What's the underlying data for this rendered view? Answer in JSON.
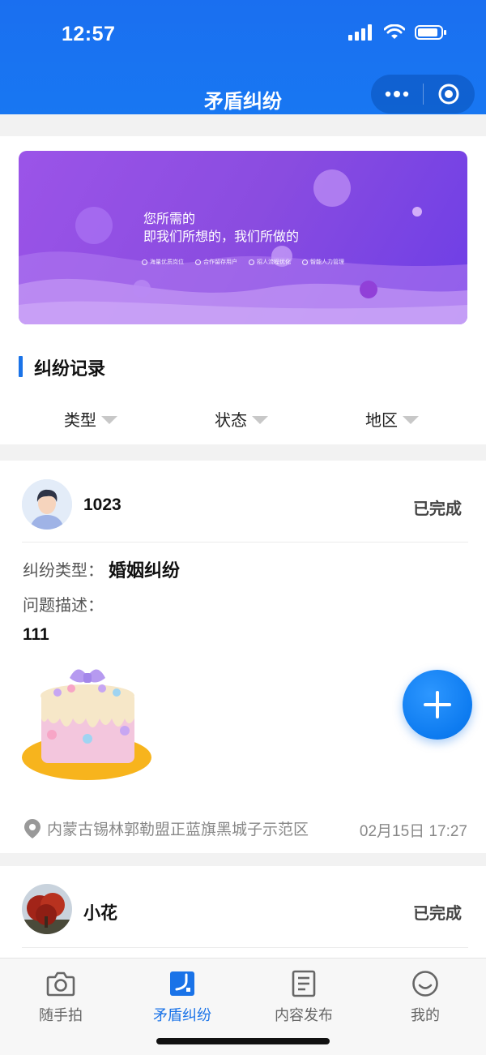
{
  "status_bar": {
    "time": "12:57"
  },
  "header": {
    "title": "矛盾纠纷"
  },
  "banner": {
    "line1": "您所需的",
    "line2": "即我们所想的，我们所做的",
    "bullets": [
      "海量优质岗位",
      "合作留存用户",
      "招人流程优化",
      "智能人力管理"
    ]
  },
  "section": {
    "title": "纠纷记录"
  },
  "filters": [
    {
      "label": "类型"
    },
    {
      "label": "状态"
    },
    {
      "label": "地区"
    }
  ],
  "records": [
    {
      "name": "1023",
      "status": "已完成",
      "type_label": "纠纷类型：",
      "type_value": "婚姻纠纷",
      "desc_label": "问题描述：",
      "desc_value": "111",
      "location": "内蒙古锡林郭勒盟正蓝旗黑城子示范区",
      "time": "02月15日 17:27"
    },
    {
      "name": "小花",
      "status": "已完成"
    }
  ],
  "tabbar": {
    "tabs": [
      {
        "label": "随手拍",
        "icon": "camera-icon"
      },
      {
        "label": "矛盾纠纷",
        "icon": "dispute-icon"
      },
      {
        "label": "内容发布",
        "icon": "document-icon"
      },
      {
        "label": "我的",
        "icon": "smiley-icon"
      }
    ],
    "active_index": 1,
    "active_color": "#1a73e8"
  },
  "colors": {
    "primary": "#1877f2",
    "accent": "#1a73e8",
    "banner": "#8a4ce0"
  }
}
